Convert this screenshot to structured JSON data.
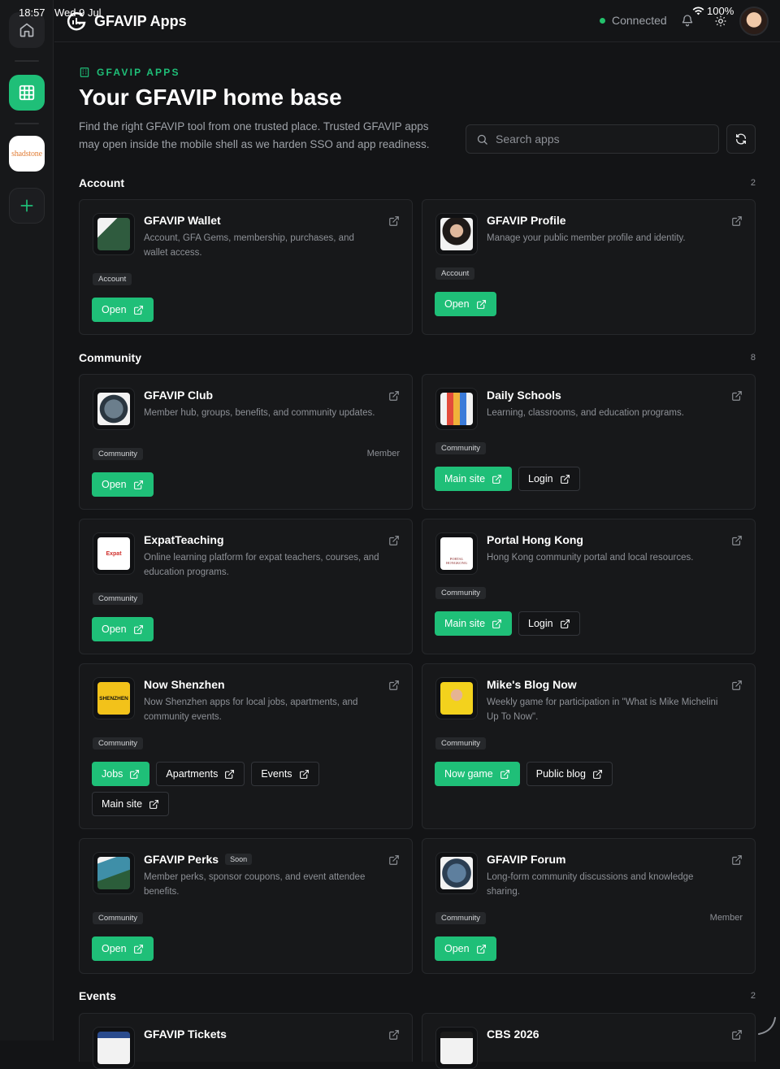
{
  "status_bar": {
    "time": "18:57",
    "date": "Wed 9 Jul",
    "battery": "100%"
  },
  "header": {
    "brand": "GFAVIP Apps",
    "connection": "Connected"
  },
  "hero": {
    "eyebrow": "GFAVIP APPS",
    "title": "Your GFAVIP home base",
    "description": "Find the right GFAVIP tool from one trusted place. Trusted GFAVIP apps may open inside the mobile shell as we harden SSO and app readiness."
  },
  "search": {
    "placeholder": "Search apps",
    "value": ""
  },
  "sidebar": {
    "shadstone_logo": "shadstone"
  },
  "sections": [
    {
      "title": "Account",
      "count": "2"
    },
    {
      "title": "Community",
      "count": "8"
    },
    {
      "title": "Events",
      "count": "2"
    }
  ],
  "cards": [
    {
      "name": "GFAVIP Wallet",
      "desc": "Account, GFA Gems, membership, purchases, and wallet access.",
      "tag": "Account",
      "buttons": [
        "Open"
      ]
    },
    {
      "name": "GFAVIP Profile",
      "desc": "Manage your public member profile and identity.",
      "tag": "Account",
      "buttons": [
        "Open"
      ]
    },
    {
      "name": "GFAVIP Club",
      "desc": "Member hub, groups, benefits, and community updates.",
      "tag": "Community",
      "access": "Member",
      "buttons": [
        "Open"
      ]
    },
    {
      "name": "Daily Schools",
      "desc": "Learning, classrooms, and education programs.",
      "tag": "Community",
      "buttons": [
        "Main site",
        "Login"
      ]
    },
    {
      "name": "ExpatTeaching",
      "desc": "Online learning platform for expat teachers, courses, and education programs.",
      "tag": "Community",
      "buttons": [
        "Open"
      ]
    },
    {
      "name": "Portal Hong Kong",
      "desc": "Hong Kong community portal and local resources.",
      "tag": "Community",
      "buttons": [
        "Main site",
        "Login"
      ]
    },
    {
      "name": "Now Shenzhen",
      "desc": "Now Shenzhen apps for local jobs, apartments, and community events.",
      "tag": "Community",
      "buttons": [
        "Jobs",
        "Apartments",
        "Events",
        "Main site"
      ]
    },
    {
      "name": "Mike's Blog Now",
      "desc": "Weekly game for participation in \"What is Mike Michelini Up To Now\".",
      "tag": "Community",
      "buttons": [
        "Now game",
        "Public blog"
      ]
    },
    {
      "name": "GFAVIP Perks",
      "badge": "Soon",
      "desc": "Member perks, sponsor coupons, and event attendee benefits.",
      "tag": "Community",
      "buttons": [
        "Open"
      ]
    },
    {
      "name": "GFAVIP Forum",
      "desc": "Long-form community discussions and knowledge sharing.",
      "tag": "Community",
      "access": "Member",
      "buttons": [
        "Open"
      ]
    },
    {
      "name": "GFAVIP Tickets"
    },
    {
      "name": "CBS 2026"
    }
  ],
  "logo_text": {
    "expat": "Expat",
    "portal": "PORTAL HONGKONG",
    "shenzhen": "SHENZHEN"
  },
  "colors": {
    "accent": "#1fbf78",
    "background": "#131416",
    "card": "#17181a",
    "connected": "#23c16b"
  },
  "icons": [
    "home-icon",
    "grid-icon",
    "plus-icon",
    "bell-icon",
    "wifi-icon",
    "sun-icon",
    "search-icon",
    "refresh-icon",
    "external-link-icon",
    "building-icon"
  ]
}
